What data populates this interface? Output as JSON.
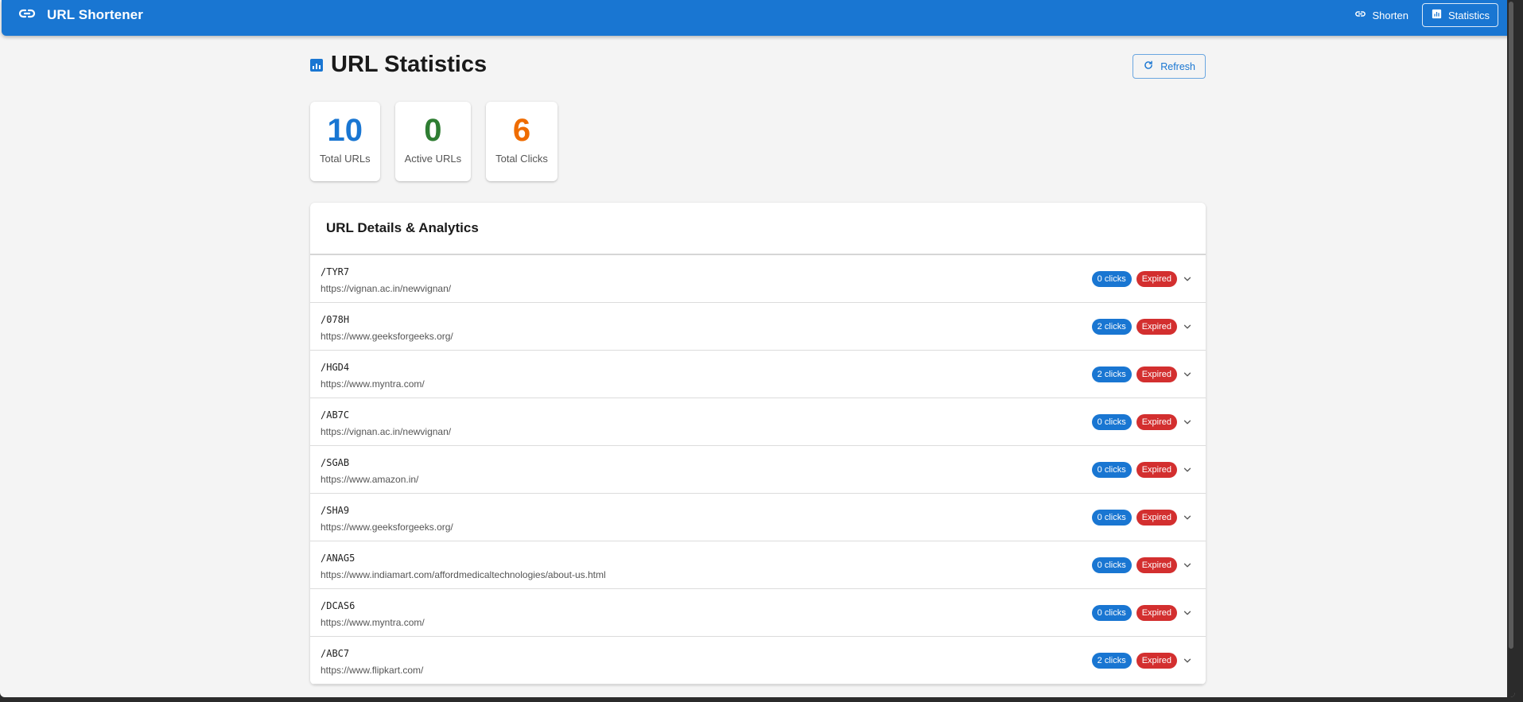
{
  "app": {
    "title": "URL Shortener"
  },
  "nav": {
    "shorten_label": "Shorten",
    "statistics_label": "Statistics"
  },
  "page": {
    "title": "URL Statistics",
    "refresh_label": "Refresh"
  },
  "stats": [
    {
      "value": "10",
      "label": "Total URLs",
      "color": "#1976d2"
    },
    {
      "value": "0",
      "label": "Active URLs",
      "color": "#2e7d32"
    },
    {
      "value": "6",
      "label": "Total Clicks",
      "color": "#ef6c00"
    }
  ],
  "details": {
    "title": "URL Details & Analytics",
    "rows": [
      {
        "code": "/TYR7",
        "url": "https://vignan.ac.in/newvignan/",
        "clicks": "0 clicks",
        "status": "Expired"
      },
      {
        "code": "/078H",
        "url": "https://www.geeksforgeeks.org/",
        "clicks": "2 clicks",
        "status": "Expired"
      },
      {
        "code": "/HGD4",
        "url": "https://www.myntra.com/",
        "clicks": "2 clicks",
        "status": "Expired"
      },
      {
        "code": "/AB7C",
        "url": "https://vignan.ac.in/newvignan/",
        "clicks": "0 clicks",
        "status": "Expired"
      },
      {
        "code": "/SGAB",
        "url": "https://www.amazon.in/",
        "clicks": "0 clicks",
        "status": "Expired"
      },
      {
        "code": "/SHA9",
        "url": "https://www.geeksforgeeks.org/",
        "clicks": "0 clicks",
        "status": "Expired"
      },
      {
        "code": "/ANAG5",
        "url": "https://www.indiamart.com/affordmedicaltechnologies/about-us.html",
        "clicks": "0 clicks",
        "status": "Expired"
      },
      {
        "code": "/DCAS6",
        "url": "https://www.myntra.com/",
        "clicks": "0 clicks",
        "status": "Expired"
      },
      {
        "code": "/ABC7",
        "url": "https://www.flipkart.com/",
        "clicks": "2 clicks",
        "status": "Expired"
      }
    ]
  },
  "colors": {
    "primary": "#1976d2",
    "expired": "#d32f2f",
    "active": "#2e7d32",
    "clicks_total": "#ef6c00"
  }
}
